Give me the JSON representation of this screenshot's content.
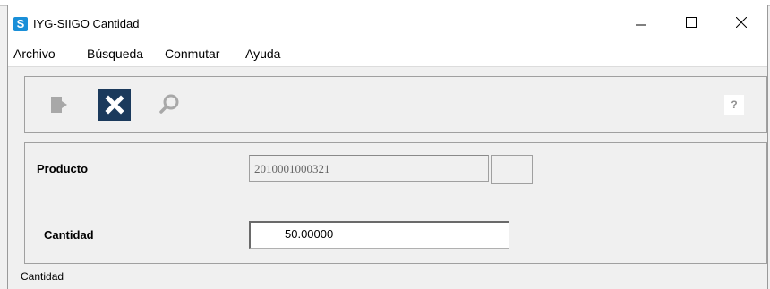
{
  "window": {
    "title": "IYG-SIIGO Cantidad",
    "logo_letter": "S",
    "controls": [
      "minimize-icon",
      "maximize-icon",
      "close-icon"
    ]
  },
  "menu": {
    "items": [
      "Archivo",
      "Búsqueda",
      "Conmutar",
      "Ayuda"
    ]
  },
  "toolbar": {
    "buttons": [
      {
        "name": "exit-button",
        "icon": "exit-door-icon",
        "active": false
      },
      {
        "name": "cancel-button",
        "icon": "x-close-icon",
        "active": true
      },
      {
        "name": "search-button",
        "icon": "search-icon",
        "active": false
      }
    ],
    "help_label": "?"
  },
  "form": {
    "product_label": "Producto",
    "product_value": "2010001000321",
    "quantity_label": "Cantidad",
    "quantity_value": "50.00000"
  },
  "status": {
    "text": "Cantidad"
  },
  "colors": {
    "logo": "#1a8fd8",
    "active_button": "#1b3a5c",
    "icon_gray": "#a8a8a8"
  }
}
